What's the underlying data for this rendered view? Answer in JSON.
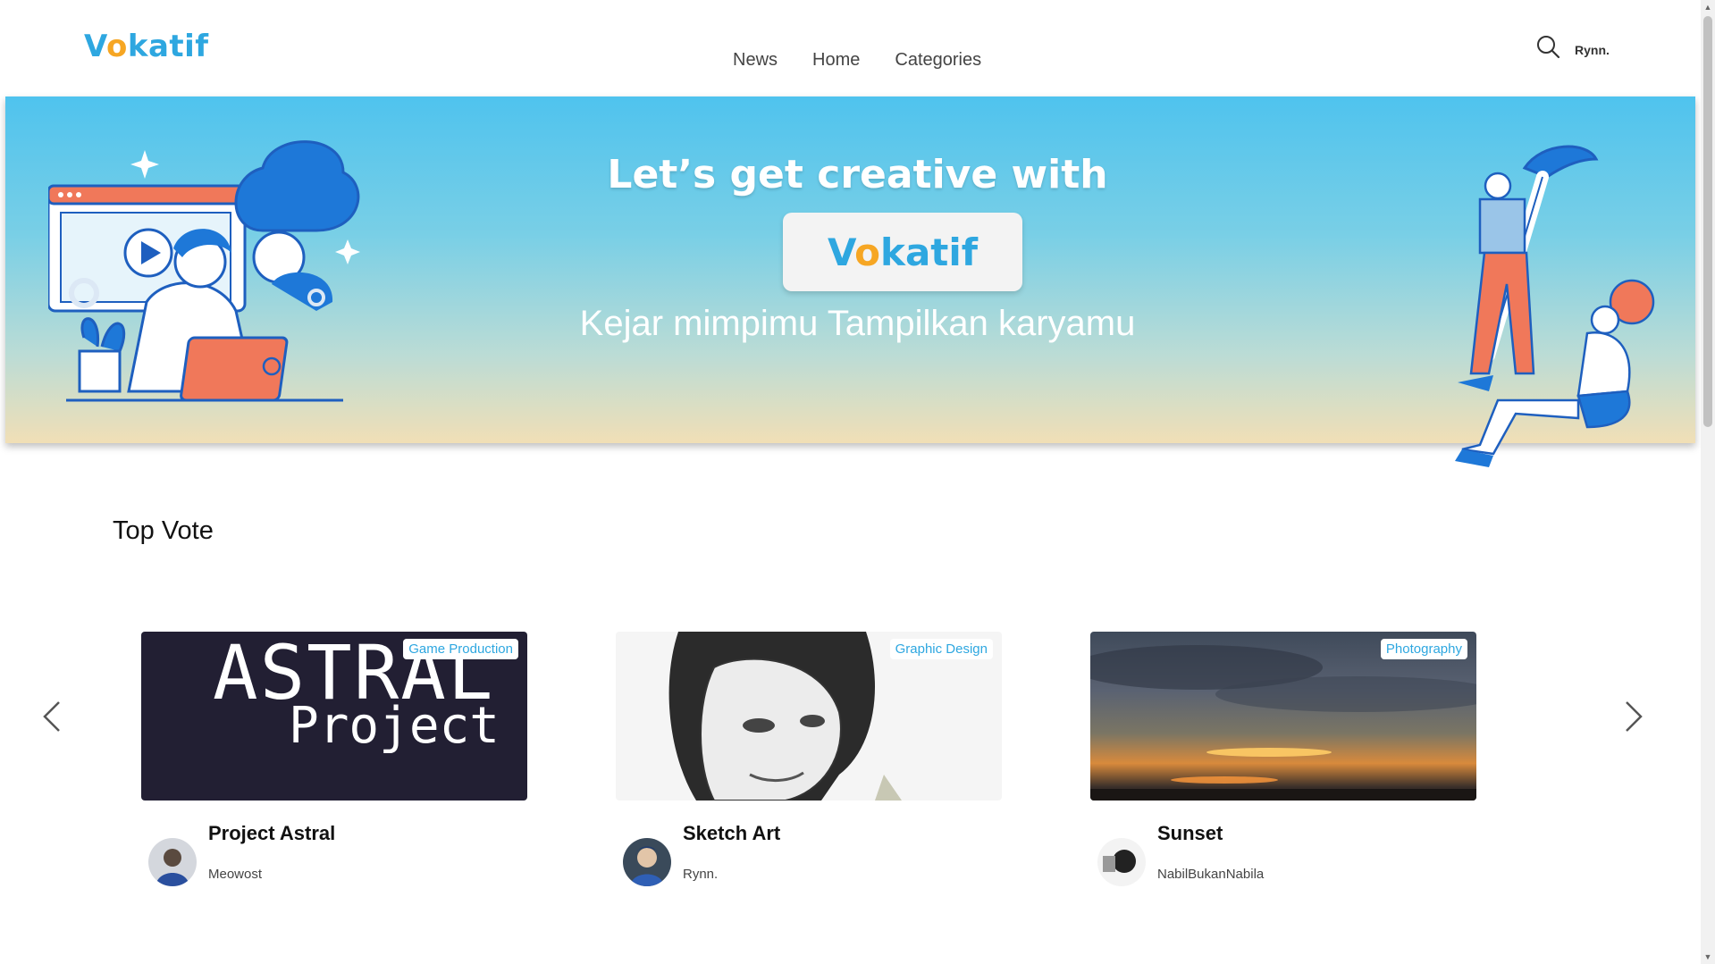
{
  "header": {
    "logo_first": "V",
    "logo_o": "o",
    "logo_rest": "katif",
    "nav": [
      "News",
      "Home",
      "Categories"
    ],
    "user": "Rynn."
  },
  "banner": {
    "headline": "Let’s get creative with",
    "logo_first": "V",
    "logo_o": "o",
    "logo_rest": "katif",
    "tagline": "Kejar mimpimu Tampilkan karyamu"
  },
  "section": {
    "title": "Top Vote"
  },
  "cards": [
    {
      "title": "Project Astral",
      "author": "Meowost",
      "category": "Game Production",
      "image_text_1": "ASTRAL",
      "image_text_2": "Project"
    },
    {
      "title": "Sketch Art",
      "author": "Rynn.",
      "category": "Graphic Design"
    },
    {
      "title": "Sunset",
      "author": "NabilBukanNabila",
      "category": "Photography"
    }
  ],
  "colors": {
    "brand_blue": "#2ea7e0",
    "brand_orange": "#f6a623",
    "accent_coral": "#f0785a"
  },
  "icons": {
    "search": "search-icon",
    "prev": "chevron-left-icon",
    "next": "chevron-right-icon"
  }
}
